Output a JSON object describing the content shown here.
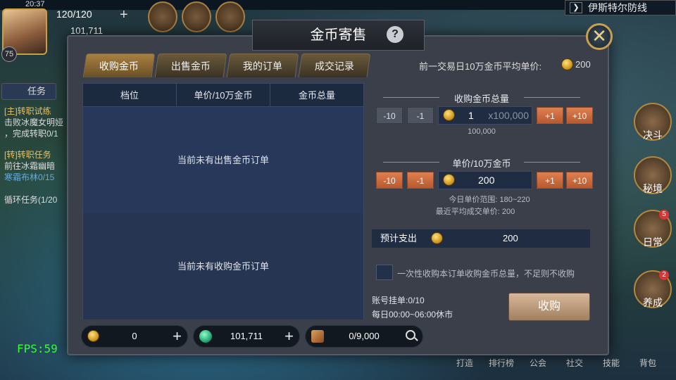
{
  "hud": {
    "time": "20:37",
    "level": "75",
    "currency_top": "120/120",
    "currency_second": "101,711",
    "zone_name": "伊斯特尔防线",
    "quest_tab": "任务",
    "quests": [
      "[主]转职试练",
      "击败冰魔女明娅",
      "，完成转职0/1",
      "[转]转职任务",
      "前往冰霜幽暗",
      "寒霜布林0/15",
      "循环任务(1/20"
    ],
    "right_buttons": [
      "决斗",
      "秘境",
      "日常",
      "养成"
    ],
    "right_badges": [
      "",
      "",
      "5",
      "2"
    ],
    "bottom_menu": [
      "打造",
      "排行榜",
      "公会",
      "社交",
      "技能",
      "背包"
    ],
    "fps": "FPS:59"
  },
  "dialog": {
    "title": "金币寄售",
    "help_label": "?",
    "close_label": "✕",
    "tabs": [
      "收购金币",
      "出售金币",
      "我的订单",
      "成交记录"
    ],
    "active_tab": 0,
    "avg_price_label": "前一交易日10万金币平均单价:",
    "avg_price_value": "200",
    "table": {
      "headers": [
        "档位",
        "单价/10万金币",
        "金币总量"
      ],
      "empty_sell": "当前未有出售金币订单",
      "empty_buy": "当前未有收购金币订单"
    },
    "buy_total": {
      "title": "收购金币总量",
      "minus10": "-10",
      "minus1": "-1",
      "value": "1",
      "unit": "x100,000",
      "plus1": "+1",
      "plus10": "+10",
      "sub": "100,000"
    },
    "unit_price": {
      "title": "单价/10万金币",
      "minus10": "-10",
      "minus1": "-1",
      "value": "200",
      "plus1": "+1",
      "plus10": "+10",
      "range_hint": "今日单价范围: 180~220",
      "recent_hint": "最近平均成交单价: 200"
    },
    "cost_label": "预计支出",
    "cost_value": "200",
    "checkbox_label": "一次性收购本订单收购金币总量，不足则不收购",
    "account_orders": "账号挂单:0/10",
    "closed_hours": "每日00:00~06:00休市",
    "buy_button": "收购"
  },
  "bottom_currency": {
    "gold": "0",
    "gems": "101,711",
    "scrolls": "0/9,000",
    "add_label": "+"
  },
  "colors": {
    "accent_orange": "#e08050",
    "gold": "#c98d18",
    "panel_bg": "#24344d"
  }
}
